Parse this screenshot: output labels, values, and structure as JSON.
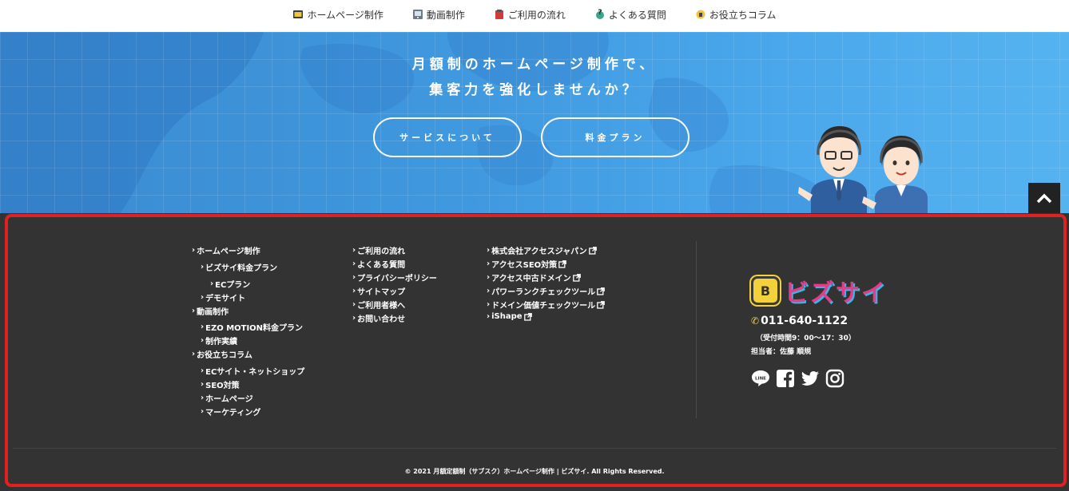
{
  "topnav": {
    "items": [
      {
        "label": "ホームページ制作",
        "icon": "homepage-icon"
      },
      {
        "label": "動画制作",
        "icon": "video-icon"
      },
      {
        "label": "ご利用の流れ",
        "icon": "flow-icon"
      },
      {
        "label": "よくある質問",
        "icon": "faq-icon"
      },
      {
        "label": "お役立ちコラム",
        "icon": "column-icon"
      }
    ]
  },
  "hero": {
    "line1": "月額制のホームページ制作で、",
    "line2": "集客力を強化しませんか？",
    "btn_service": "サービスについて",
    "btn_price": "料金プラン"
  },
  "footer": {
    "col1": [
      "ホームページ制作",
      "ビズサイ料金プラン",
      "ECプラン",
      "デモサイト",
      "動画制作",
      "EZO MOTION料金プラン",
      "制作実績",
      "お役立ちコラム",
      "ECサイト・ネットショップ",
      "SEO対策",
      "ホームページ",
      "マーケティング"
    ],
    "col2": [
      "ご利用の流れ",
      "よくある質問",
      "プライバシーポリシー",
      "サイトマップ",
      "ご利用者様へ",
      "お問い合わせ"
    ],
    "col3": [
      "株式会社アクセスジャパン",
      "アクセスSEO対策",
      "アクセス中古ドメイン",
      "パワーランクチェックツール",
      "ドメイン価値チェックツール",
      "iShape"
    ],
    "logo_text": "ビズサイ",
    "logo_badge": "B",
    "phone": "011-640-1122",
    "hours": "（受付時間9：00～17：30）",
    "staff": "担当者：佐藤 順規",
    "socials": [
      "line-icon",
      "facebook-icon",
      "twitter-icon",
      "instagram-icon"
    ],
    "copyright": "© 2021 月額定額制（サブスク）ホームページ制作 | ビズサイ. All Rights Reserved."
  },
  "colors": {
    "footer_bg": "#333333",
    "hero_blue": "#3f97dd",
    "highlight_frame": "#e12121",
    "logo_pink": "#e33d8a",
    "logo_yellow": "#f2d13a"
  }
}
